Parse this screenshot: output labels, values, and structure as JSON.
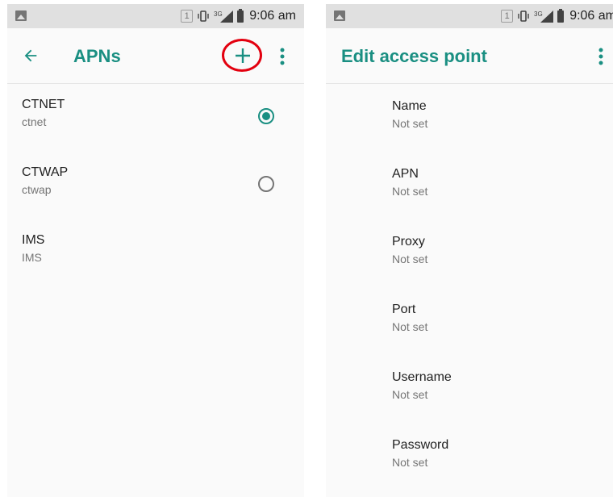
{
  "status_bar": {
    "sim_slot": "1",
    "network_type": "3G",
    "time": "9:06 am"
  },
  "apns_screen": {
    "title": "APNs",
    "items": [
      {
        "name": "CTNET",
        "apn": "ctnet",
        "selected": true,
        "has_radio": true
      },
      {
        "name": "CTWAP",
        "apn": "ctwap",
        "selected": false,
        "has_radio": true
      },
      {
        "name": "IMS",
        "apn": "IMS",
        "selected": false,
        "has_radio": false
      }
    ],
    "icons": [
      "back-arrow-icon",
      "add-icon",
      "more-vert-icon"
    ],
    "highlight_color": "#e3000f"
  },
  "edit_screen": {
    "title": "Edit access point",
    "fields": [
      {
        "label": "Name",
        "value": "Not set"
      },
      {
        "label": "APN",
        "value": "Not set"
      },
      {
        "label": "Proxy",
        "value": "Not set"
      },
      {
        "label": "Port",
        "value": "Not set"
      },
      {
        "label": "Username",
        "value": "Not set"
      },
      {
        "label": "Password",
        "value": "Not set"
      }
    ]
  },
  "colors": {
    "accent": "#1a8f82",
    "status_bar_bg": "#e0e0e0",
    "screen_bg": "#fafafa",
    "primary_text": "#212121",
    "secondary_text": "#757575"
  }
}
